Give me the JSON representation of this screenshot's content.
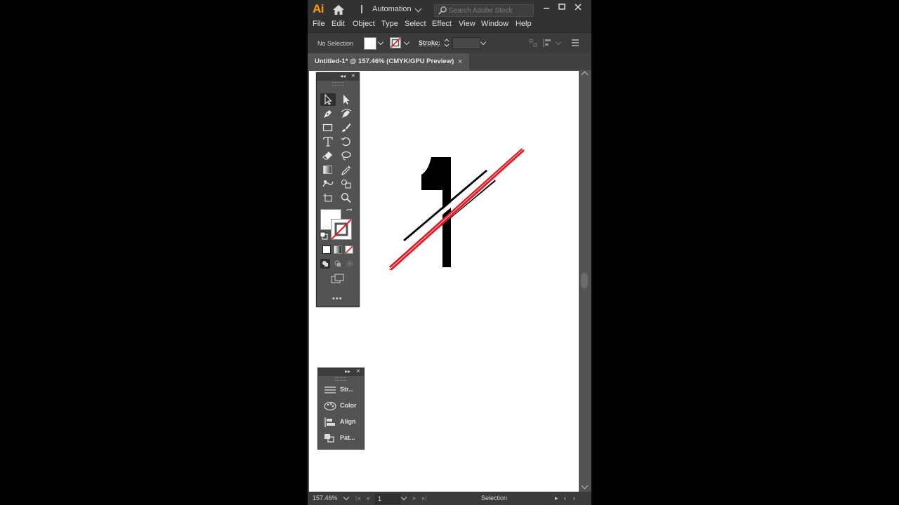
{
  "app": {
    "logo": "Ai",
    "workspace": "Automation",
    "stock_placeholder": "Search Adobe Stock"
  },
  "menu": {
    "items": [
      "File",
      "Edit",
      "Object",
      "Type",
      "Select",
      "Effect",
      "View",
      "Window",
      "Help"
    ]
  },
  "control_bar": {
    "selection_label": "No Selection",
    "stroke_label": "Stroke:",
    "fill_color": "#ffffff"
  },
  "document": {
    "tab_title": "Untitled-1* @ 157.46% (CMYK/GPU Preview)",
    "close_glyph": "×"
  },
  "status_bar": {
    "zoom": "157.46%",
    "page": "1",
    "tool_status": "Selection"
  },
  "tools_panel": {
    "collapse_glyph": "◂◂",
    "close_glyph": "×",
    "more_glyph": "•••",
    "tools": [
      "selection-tool",
      "direct-selection-tool",
      "pen-tool",
      "curvature-tool",
      "rectangle-tool",
      "paintbrush-tool",
      "type-tool",
      "rotate-tool",
      "eraser-tool",
      "lasso-tool",
      "gradient-tool",
      "eyedropper-tool",
      "puppet-warp-tool",
      "shape-builder-tool",
      "artboard-tool",
      "zoom-tool"
    ]
  },
  "mini_panel": {
    "collapse_glyph": "▸▸",
    "close_glyph": "×",
    "items": [
      {
        "label": "Str...",
        "icon": "stroke-icon"
      },
      {
        "label": "Color",
        "icon": "color-palette-icon"
      },
      {
        "label": "Align",
        "icon": "align-icon"
      },
      {
        "label": "Pat...",
        "icon": "pathfinder-icon"
      }
    ]
  },
  "artwork": {
    "digit": "1",
    "digit_color": "#000000",
    "accent_color": "#e31b23",
    "slash_color": "#000000"
  },
  "colors": {
    "accent": "#ff9a00",
    "panel_bg": "#535353",
    "bar_bg": "#323232"
  }
}
